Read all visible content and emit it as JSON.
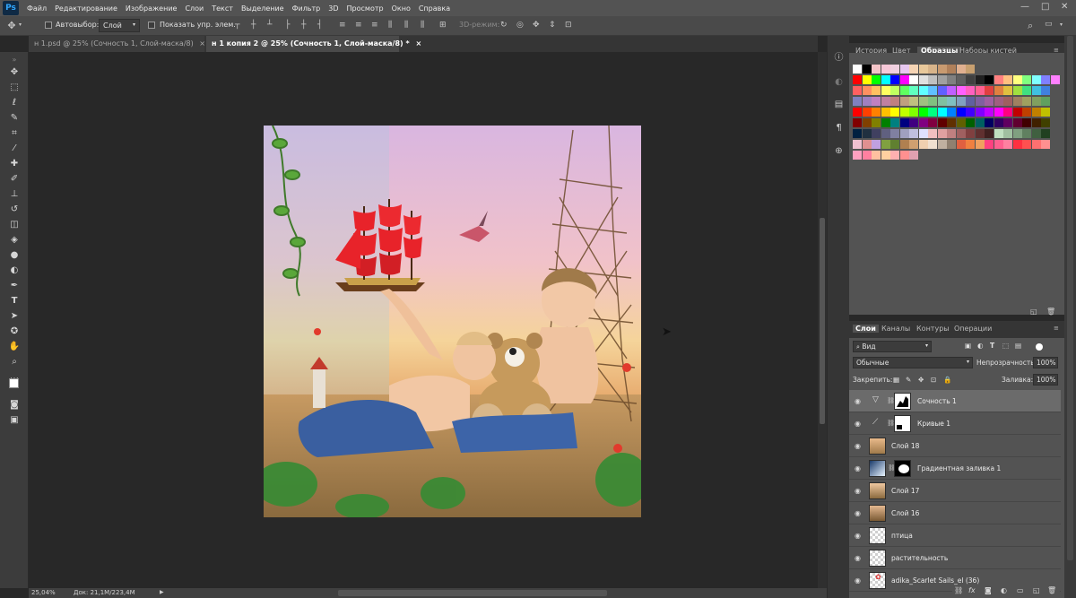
{
  "app": {
    "logo": "Ps"
  },
  "menu": [
    "Файл",
    "Редактирование",
    "Изображение",
    "Слои",
    "Текст",
    "Выделение",
    "Фильтр",
    "3D",
    "Просмотр",
    "Окно",
    "Справка"
  ],
  "window_controls": {
    "minimize": "—",
    "maximize": "□",
    "close": "✕"
  },
  "options": {
    "autoselect_label": "Автовыбор:",
    "autoselect_value": "Слой",
    "show_controls_label": "Показать упр. элем.",
    "mode3d_label": "3D-режим:"
  },
  "tabs": [
    {
      "label": "н 1.psd @ 25% (Сочность 1, Слой-маска/8)",
      "close": "×",
      "active": false
    },
    {
      "label": "н 1 копия 2 @ 25% (Сочность 1, Слой-маска/8) *",
      "close": "×",
      "active": true
    }
  ],
  "statusbar": {
    "zoom": "25,04%",
    "doc": "Док: 21,1M/223,4M",
    "arrow": "▶"
  },
  "swatches_tabs": [
    "История",
    "Цвет",
    "Образцы",
    "Наборы кистей"
  ],
  "swatches_active": "Образцы",
  "layers_tabs": [
    "Слои",
    "Каналы",
    "Контуры",
    "Операции"
  ],
  "layers_active": "Слои",
  "layers": {
    "filter_value": "Вид",
    "blend_mode": "Обычные",
    "opacity_label": "Непрозрачность:",
    "opacity_value": "100%",
    "lock_label": "Закрепить:",
    "fill_label": "Заливка:",
    "fill_value": "100%",
    "items": [
      {
        "name": "Сочность 1",
        "selected": true
      },
      {
        "name": "Кривые 1",
        "selected": false
      },
      {
        "name": "Слой 18",
        "selected": false
      },
      {
        "name": "Градиентная заливка 1",
        "selected": false
      },
      {
        "name": "Слой 17",
        "selected": false
      },
      {
        "name": "Слой 16",
        "selected": false
      },
      {
        "name": "птица",
        "selected": false
      },
      {
        "name": "растительность",
        "selected": false
      },
      {
        "name": "adika_Scarlet Sails_el (36)",
        "selected": false
      }
    ],
    "bottom_icons": [
      "link-icon",
      "fx-icon",
      "mask-icon",
      "adjustment-icon",
      "folder-icon",
      "new-layer-icon",
      "trash-icon"
    ]
  },
  "colors": {
    "menubar": "#535353",
    "panel": "#535353",
    "canvas_bg": "#282828",
    "accent": "#31a8ff"
  }
}
